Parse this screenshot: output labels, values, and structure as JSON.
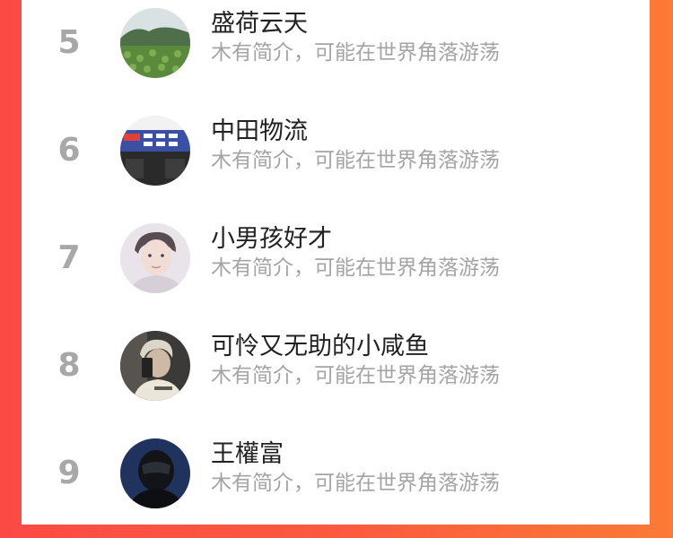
{
  "ranking_list": {
    "rows": [
      {
        "rank": "5",
        "name": "盛荷云天",
        "bio": "木有简介，可能在世界角落游荡",
        "avatar": "lotus-pond-landscape"
      },
      {
        "rank": "6",
        "name": "中田物流",
        "bio": "木有简介，可能在世界角落游荡",
        "avatar": "storefront-sign"
      },
      {
        "rank": "7",
        "name": "小男孩好才",
        "bio": "木有简介，可能在世界角落游荡",
        "avatar": "boy-portrait"
      },
      {
        "rank": "8",
        "name": "可怜又无助的小咸鱼",
        "bio": "木有简介，可能在世界角落游荡",
        "avatar": "mirror-selfie"
      },
      {
        "rank": "9",
        "name": "王權富",
        "bio": "木有简介，可能在世界角落游荡",
        "avatar": "helmet-rider"
      }
    ]
  },
  "colors": {
    "rank": "#a8a8a8",
    "name": "#222222",
    "bio": "#a4a4a4",
    "background_gradient": [
      "#fb4a45",
      "#fb7a35"
    ]
  }
}
